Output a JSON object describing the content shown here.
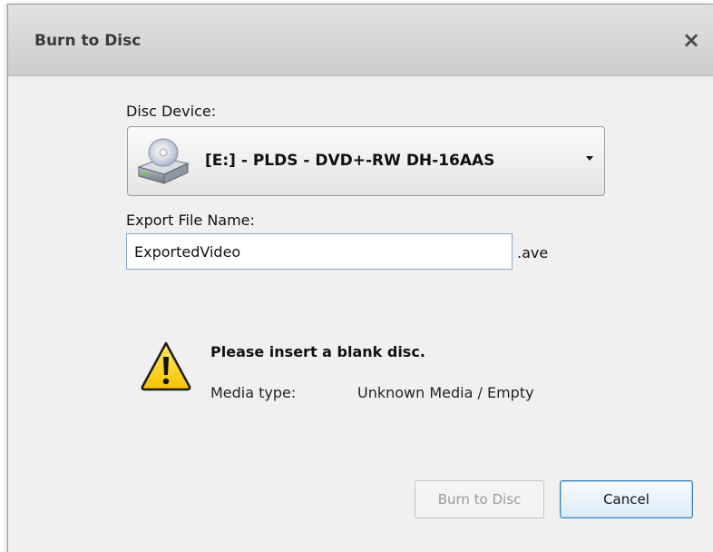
{
  "dialog": {
    "title": "Burn to Disc",
    "close_label": "×"
  },
  "device": {
    "label": "Disc Device:",
    "selected": "[E:] - PLDS - DVD+-RW DH-16AAS",
    "icon": "disc-drive-icon"
  },
  "export": {
    "label": "Export File Name:",
    "value": "ExportedVideo",
    "extension": ".ave"
  },
  "status": {
    "icon": "warning-icon",
    "message": "Please insert a blank disc.",
    "media_type_label": "Media type:",
    "media_type_value": "Unknown Media / Empty"
  },
  "buttons": {
    "burn_label": "Burn to Disc",
    "burn_enabled": false,
    "cancel_label": "Cancel"
  },
  "colors": {
    "warning_fill": "#ffd200",
    "focus_border": "#3c7fb1"
  }
}
